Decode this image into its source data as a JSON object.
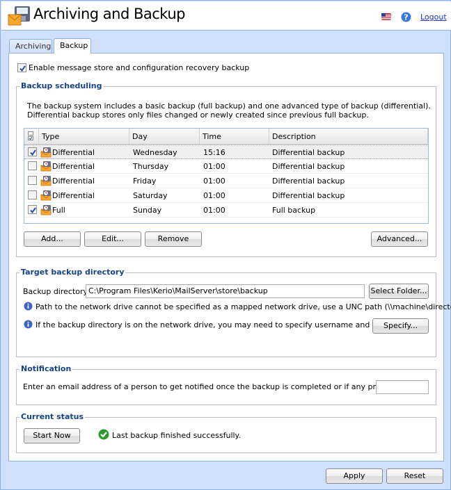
{
  "header": {
    "title": "Archiving and Backup",
    "logout_label": "Logout",
    "icons": {
      "app": "mail-disk-icon",
      "language": "us-flag-icon",
      "help": "help-icon"
    }
  },
  "tabs": [
    {
      "label": "Archiving",
      "active": false
    },
    {
      "label": "Backup",
      "active": true
    }
  ],
  "enable_backup": {
    "label": "Enable message store and configuration recovery backup",
    "checked": true
  },
  "scheduling": {
    "legend": "Backup scheduling",
    "description_line1": "The backup system includes a basic backup (full backup) and one advanced type of backup (differential).",
    "description_line2": "Differential backup stores only files changed or newly created since previous full backup.",
    "columns": [
      "Type",
      "Day",
      "Time",
      "Description"
    ],
    "rows": [
      {
        "checked": true,
        "type": "Differential",
        "day": "Wednesday",
        "time": "15:16",
        "description": "Differential backup",
        "selected": true
      },
      {
        "checked": false,
        "type": "Differential",
        "day": "Thursday",
        "time": "01:00",
        "description": "Differential backup",
        "selected": false
      },
      {
        "checked": false,
        "type": "Differential",
        "day": "Friday",
        "time": "01:00",
        "description": "Differential backup",
        "selected": false
      },
      {
        "checked": false,
        "type": "Differential",
        "day": "Saturday",
        "time": "01:00",
        "description": "Differential backup",
        "selected": false
      },
      {
        "checked": true,
        "type": "Full",
        "day": "Sunday",
        "time": "01:00",
        "description": "Full backup",
        "selected": false
      }
    ],
    "buttons": {
      "add": "Add...",
      "edit": "Edit...",
      "remove": "Remove",
      "advanced": "Advanced..."
    }
  },
  "target": {
    "legend": "Target backup directory",
    "dir_label": "Backup directory:",
    "dir_value": "C:\\Program Files\\Kerio\\MailServer\\store\\backup",
    "select_folder": "Select Folder...",
    "info1": "Path to the network drive cannot be specified as a mapped network drive, use a UNC path (\\\\machine\\directory).",
    "info2": "If the backup directory is on the network drive, you may need to specify username and password.",
    "specify": "Specify..."
  },
  "notification": {
    "legend": "Notification",
    "label": "Enter an email address of a person to get notified once the backup is completed or if any problems arise:",
    "email_value": ""
  },
  "status": {
    "legend": "Current status",
    "start_now": "Start Now",
    "message": "Last backup finished successfully."
  },
  "footer": {
    "apply": "Apply",
    "reset": "Reset"
  },
  "colors": {
    "accent": "#15428b",
    "panel_bg": "#cfdffd",
    "border": "#8eb2e0",
    "link": "#1a33cc"
  }
}
